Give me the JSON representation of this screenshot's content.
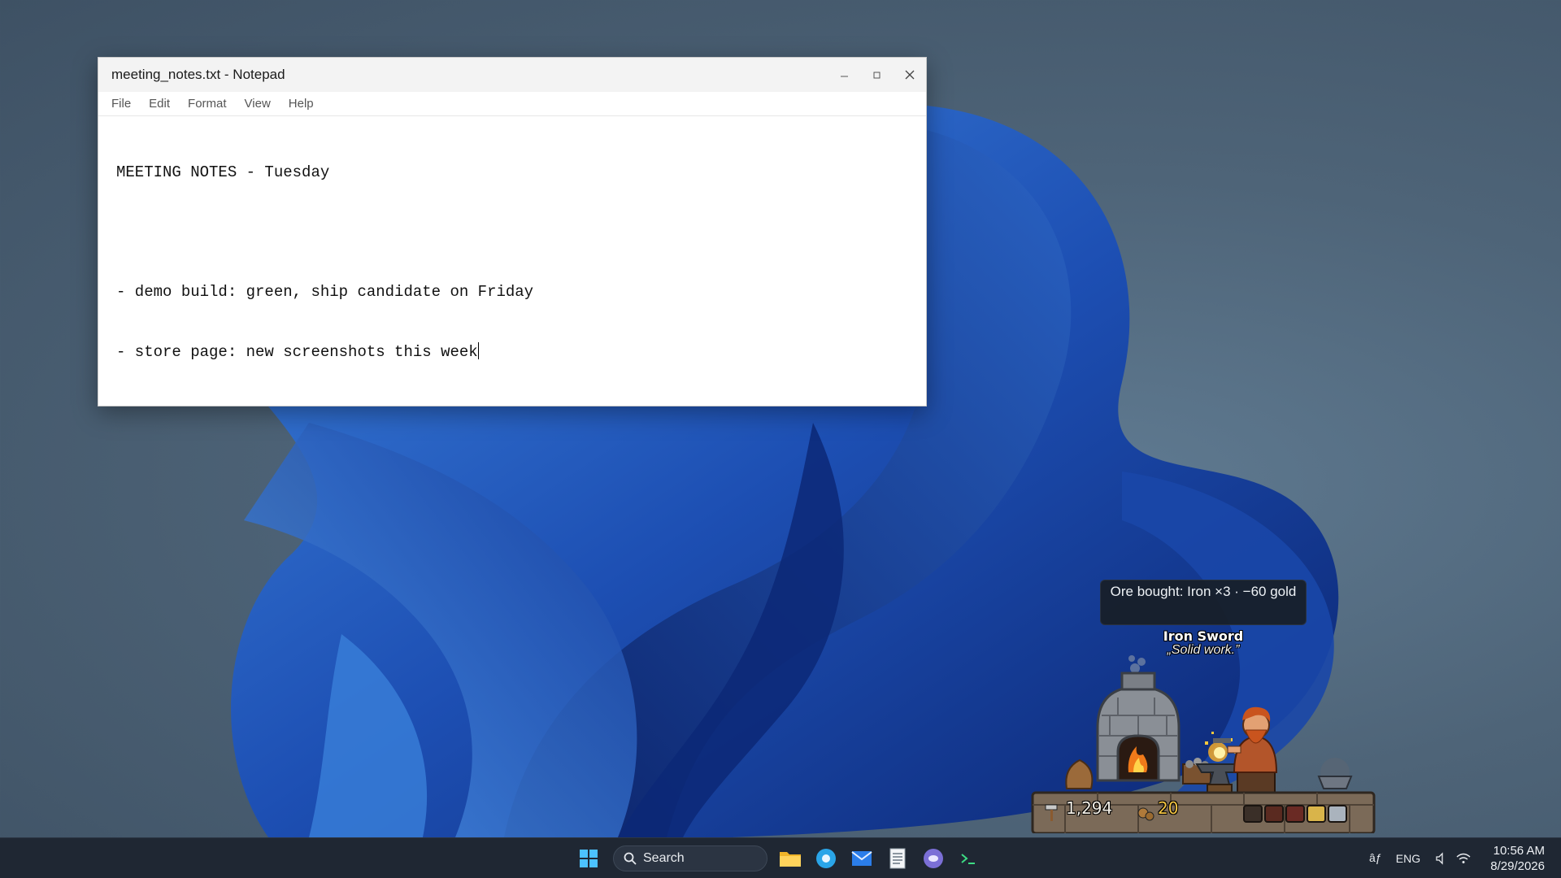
{
  "colors": {
    "desktop": "#4e6478",
    "bloom_dark": "#0d2a78",
    "bloom_light": "#2f6fd0",
    "taskbar": "#1f2733",
    "toast_bg": "#181e26",
    "ore_text": "#f5c542"
  },
  "notepad": {
    "title": "meeting_notes.txt - Notepad",
    "controls": {
      "minimize_icon": "minimize-icon",
      "maximize_icon": "maximize-icon",
      "close_icon": "close-icon"
    },
    "menu": [
      "File",
      "Edit",
      "Format",
      "View",
      "Help"
    ],
    "lines": [
      "MEETING NOTES - Tuesday",
      "",
      "- demo build: green, ship candidate on Friday",
      "- store page: new screenshots this week"
    ]
  },
  "game": {
    "toast": "Ore bought: Iron ×3 · −60 gold",
    "item_name": "Iron Sword",
    "item_quote": "„Solid work.”",
    "gold": "1,294",
    "ore": "20",
    "hud_icons": [
      "hammer-icon",
      "ore-icon",
      "anvil-slot-icon",
      "chest-slot-icon",
      "shield-slot-icon",
      "book-slot-icon",
      "ingot-slot-icon"
    ]
  },
  "taskbar": {
    "search_label": "Search",
    "pinned": [
      "start-icon",
      "file-explorer-icon",
      "browser-icon",
      "mail-icon",
      "notepad-icon",
      "chat-icon",
      "terminal-icon"
    ],
    "tray_icons_text": "âƒ",
    "language": "ENG",
    "time": "10:56 AM",
    "date": "8/29/2026"
  }
}
